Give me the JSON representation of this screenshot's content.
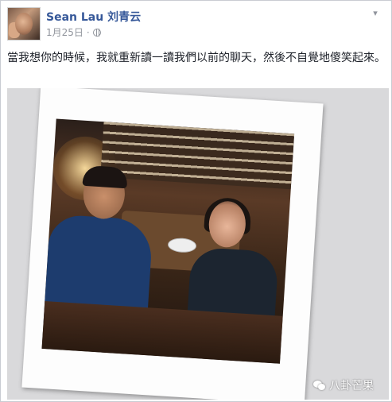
{
  "post": {
    "author_name": "Sean Lau 刘青云",
    "date": "1月25日",
    "privacy_icon": "globe-icon",
    "menu_icon": "chevron-down-icon",
    "text": "當我想你的時候，我就重新讀一讀我們以前的聊天，然後不自覺地傻笑起來。"
  },
  "photo": {
    "content": "polaroid-photo"
  },
  "watermark": {
    "icon": "wechat-icon",
    "text": "八卦芒果"
  },
  "colors": {
    "author_link": "#365899",
    "meta_gray": "#90949c",
    "body_text": "#1d2129"
  }
}
